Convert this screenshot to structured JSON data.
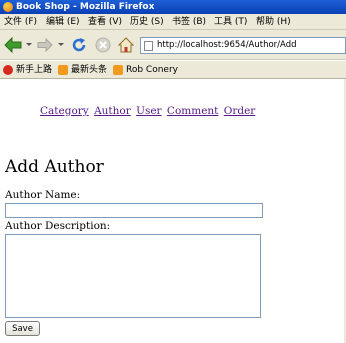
{
  "window": {
    "title": "Book Shop - Mozilla Firefox"
  },
  "menu": [
    {
      "label": "文件 (F)"
    },
    {
      "label": "编辑 (E)"
    },
    {
      "label": "查看 (V)"
    },
    {
      "label": "历史 (S)"
    },
    {
      "label": "书签 (B)"
    },
    {
      "label": "工具 (T)"
    },
    {
      "label": "帮助 (H)"
    }
  ],
  "address": {
    "url": "http://localhost:9654/Author/Add"
  },
  "bookmarks": [
    {
      "label": "新手上路",
      "icon": "firefox-start-icon"
    },
    {
      "label": "最新头条",
      "icon": "rss-feed-icon"
    },
    {
      "label": "Rob Conery",
      "icon": "rss-feed-icon"
    }
  ],
  "nav": {
    "links": [
      {
        "label": "Category"
      },
      {
        "label": "Author"
      },
      {
        "label": "User"
      },
      {
        "label": "Comment"
      },
      {
        "label": "Order"
      }
    ]
  },
  "form": {
    "title": "Add Author",
    "name_label": "Author Name:",
    "name_value": "",
    "description_label": "Author Description:",
    "description_value": "",
    "save_label": "Save"
  },
  "colors": {
    "link_visited": "#551a8b",
    "titlebar": "#0a3fb4",
    "chrome": "#ece9d8"
  }
}
